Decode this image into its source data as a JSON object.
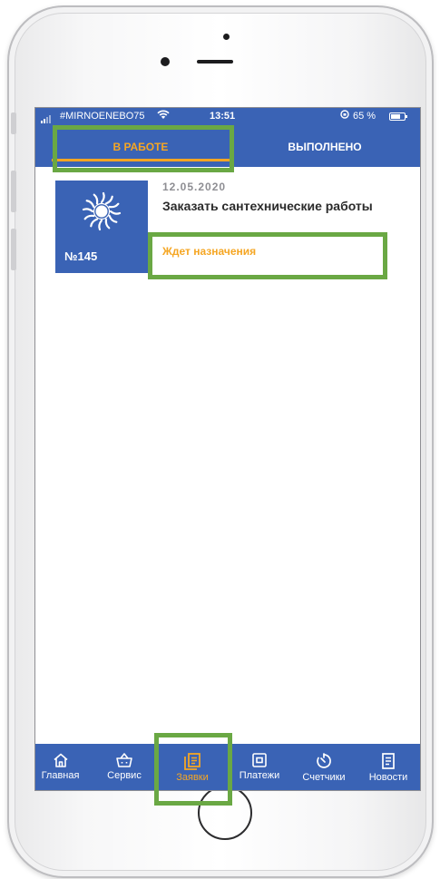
{
  "status_bar": {
    "carrier": "#MIRNOENEBO75",
    "time": "13:51",
    "battery": "65 %"
  },
  "tabs": [
    {
      "label": "В РАБОТЕ",
      "active": true
    },
    {
      "label": "ВЫПОЛНЕНО",
      "active": false
    }
  ],
  "request": {
    "number": "№145",
    "date": "12.05.2020",
    "title": "Заказать сантехнические работы",
    "status": "Ждет назначения"
  },
  "bottom_nav": [
    {
      "label": "Главная",
      "icon": "home-icon"
    },
    {
      "label": "Сервис",
      "icon": "basket-icon"
    },
    {
      "label": "Заявки",
      "icon": "requests-icon",
      "active": true
    },
    {
      "label": "Платежи",
      "icon": "wallet-icon"
    },
    {
      "label": "Счетчики",
      "icon": "meter-icon"
    },
    {
      "label": "Новости",
      "icon": "news-icon"
    }
  ],
  "colors": {
    "brand": "#3a63b5",
    "accent": "#f5a623",
    "highlight": "#6aa844"
  }
}
